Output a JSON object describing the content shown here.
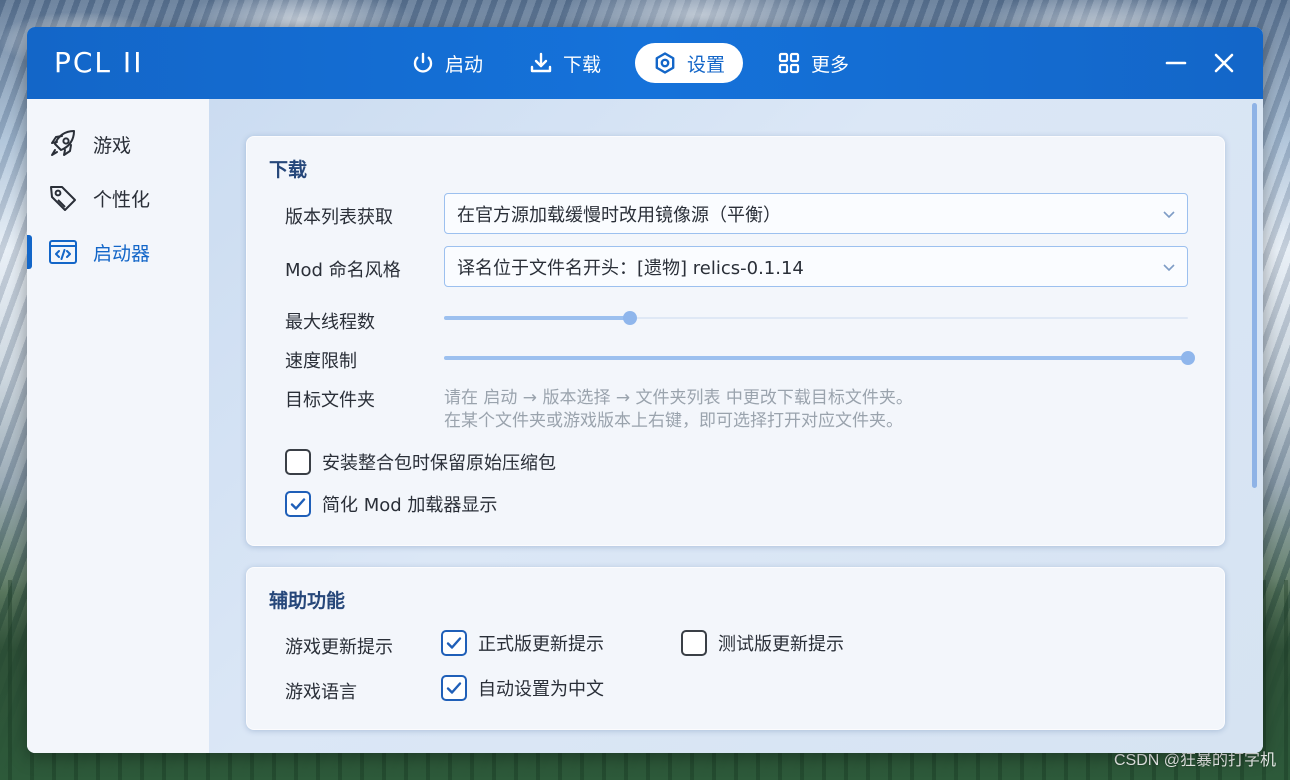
{
  "app": {
    "title": "PCL II"
  },
  "nav": [
    {
      "label": "启动",
      "icon": "power-icon"
    },
    {
      "label": "下载",
      "icon": "download-icon"
    },
    {
      "label": "设置",
      "icon": "settings-icon",
      "active": true
    },
    {
      "label": "更多",
      "icon": "grid-icon"
    }
  ],
  "sidebar": {
    "items": [
      {
        "label": "游戏",
        "icon": "rocket-icon"
      },
      {
        "label": "个性化",
        "icon": "tag-icon"
      },
      {
        "label": "启动器",
        "icon": "code-icon",
        "active": true
      }
    ]
  },
  "download": {
    "title": "下载",
    "version_list_label": "版本列表获取",
    "version_list_value": "在官方源加载缓慢时改用镜像源（平衡）",
    "mod_naming_label": "Mod 命名风格",
    "mod_naming_value": "译名位于文件名开头：[遗物] relics-0.1.14",
    "max_threads_label": "最大线程数",
    "max_threads_fraction": 0.25,
    "speed_limit_label": "速度限制",
    "speed_limit_fraction": 1.0,
    "target_folder_label": "目标文件夹",
    "target_folder_hint_1": "请在 启动 → 版本选择 → 文件夹列表 中更改下载目标文件夹。",
    "target_folder_hint_2": "在某个文件夹或游戏版本上右键，即可选择打开对应文件夹。",
    "keep_archive_label": "安装整合包时保留原始压缩包",
    "keep_archive_checked": false,
    "simplify_mod_loader_label": "简化 Mod 加载器显示",
    "simplify_mod_loader_checked": true
  },
  "assist": {
    "title": "辅助功能",
    "update_label": "游戏更新提示",
    "release_update_label": "正式版更新提示",
    "release_update_checked": true,
    "snapshot_update_label": "测试版更新提示",
    "snapshot_update_checked": false,
    "language_label": "游戏语言",
    "auto_chinese_label": "自动设置为中文",
    "auto_chinese_checked": true
  },
  "watermark": "CSDN @狂暴的打字机",
  "colors": {
    "accent": "#1366c8",
    "card_title": "#26477a",
    "hint": "#9aa3ad"
  }
}
